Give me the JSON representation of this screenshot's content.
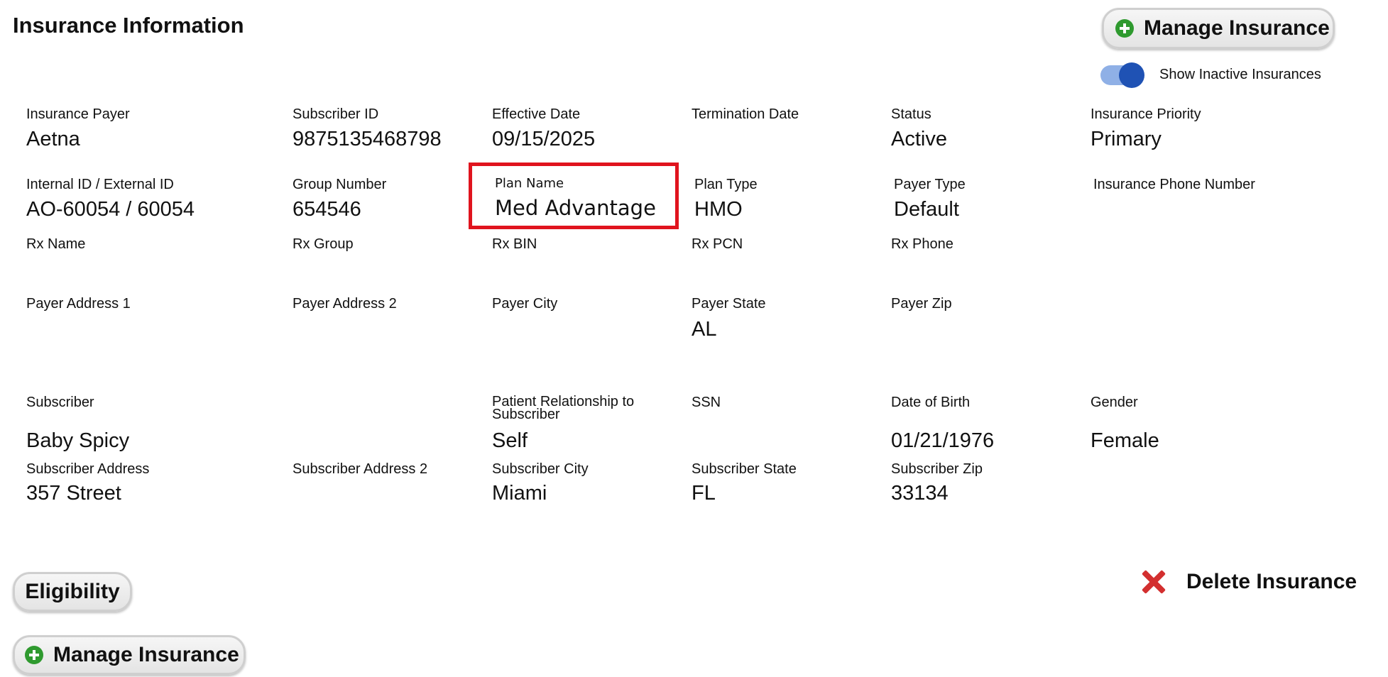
{
  "header": {
    "title": "Insurance Information"
  },
  "actions": {
    "manage_insurance": "Manage Insurance",
    "show_inactive_label": "Show Inactive Insurances",
    "eligibility": "Eligibility",
    "delete_insurance": "Delete Insurance"
  },
  "toggle": {
    "show_inactive": true
  },
  "fields": {
    "insurance_payer": {
      "label": "Insurance Payer",
      "value": "Aetna"
    },
    "subscriber_id": {
      "label": "Subscriber ID",
      "value": "9875135468798"
    },
    "effective_date": {
      "label": "Effective Date",
      "value": "09/15/2025"
    },
    "termination_date": {
      "label": "Termination Date",
      "value": ""
    },
    "status": {
      "label": "Status",
      "value": "Active"
    },
    "insurance_priority": {
      "label": "Insurance Priority",
      "value": "Primary"
    },
    "internal_external_id": {
      "label": "Internal ID / External ID",
      "value": "AO-60054 / 60054"
    },
    "group_number": {
      "label": "Group Number",
      "value": "654546"
    },
    "plan_name": {
      "label": "Plan Name",
      "value": "Med Advantage"
    },
    "plan_type": {
      "label": "Plan Type",
      "value": "HMO"
    },
    "payer_type": {
      "label": "Payer Type",
      "value": "Default"
    },
    "insurance_phone": {
      "label": "Insurance Phone Number",
      "value": ""
    },
    "rx_name": {
      "label": "Rx Name",
      "value": ""
    },
    "rx_group": {
      "label": "Rx Group",
      "value": ""
    },
    "rx_bin": {
      "label": "Rx BIN",
      "value": ""
    },
    "rx_pcn": {
      "label": "Rx PCN",
      "value": ""
    },
    "rx_phone": {
      "label": "Rx Phone",
      "value": ""
    },
    "payer_address_1": {
      "label": "Payer Address 1",
      "value": ""
    },
    "payer_address_2": {
      "label": "Payer Address 2",
      "value": ""
    },
    "payer_city": {
      "label": "Payer City",
      "value": ""
    },
    "payer_state": {
      "label": "Payer State",
      "value": "AL"
    },
    "payer_zip": {
      "label": "Payer Zip",
      "value": ""
    },
    "subscriber": {
      "label": "Subscriber",
      "value": "Baby Spicy"
    },
    "patient_relationship": {
      "label": "Patient Relationship to Subscriber",
      "value": "Self"
    },
    "ssn": {
      "label": "SSN",
      "value": ""
    },
    "date_of_birth": {
      "label": "Date of Birth",
      "value": "01/21/1976"
    },
    "gender": {
      "label": "Gender",
      "value": "Female"
    },
    "subscriber_address": {
      "label": "Subscriber Address",
      "value": "357 Street"
    },
    "subscriber_address_2": {
      "label": "Subscriber Address 2",
      "value": ""
    },
    "subscriber_city": {
      "label": "Subscriber City",
      "value": "Miami"
    },
    "subscriber_state": {
      "label": "Subscriber State",
      "value": "FL"
    },
    "subscriber_zip": {
      "label": "Subscriber Zip",
      "value": "33134"
    }
  },
  "colors": {
    "highlight_border": "#e0141e",
    "toggle_track": "#8fb0e6",
    "toggle_knob": "#1f52b4",
    "plus_icon": "#2f9a2f",
    "delete_icon": "#d32f2f"
  }
}
